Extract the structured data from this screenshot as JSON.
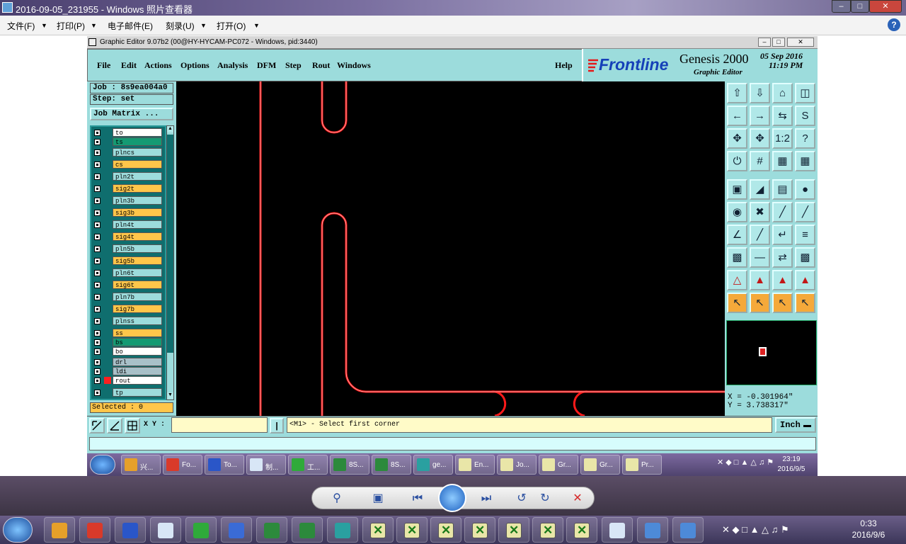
{
  "viewer": {
    "title": "2016-09-05_231955 - Windows 照片查看器",
    "menu": [
      "文件(F)",
      "打印(P)",
      "电子邮件(E)",
      "刻录(U)",
      "打开(O)"
    ],
    "help_icon": "?"
  },
  "genesis": {
    "window_title": "Graphic Editor 9.07b2 (00@HY-HYCAM-PC072 - Windows, pid:3440)",
    "menu": [
      "File",
      "Edit",
      "Actions",
      "Options",
      "Analysis",
      "DFM",
      "Step",
      "Rout",
      "Windows"
    ],
    "help": "Help",
    "brand": "Frontline",
    "product": "Genesis 2000",
    "subtitle": "Graphic Editor",
    "date": "05 Sep 2016",
    "time": "11:19 PM",
    "job": "Job : 8s9ea004a0",
    "step": "Step: set",
    "job_matrix": "Job Matrix ...",
    "layers": [
      {
        "name": "to",
        "color": "#ffffff"
      },
      {
        "name": "ts",
        "color": "#149a73"
      },
      {
        "name": "plncs",
        "color": "#9cdcdc"
      },
      {
        "name": "cs",
        "color": "#ffc64a"
      },
      {
        "name": "pln2t",
        "color": "#9cdcdc"
      },
      {
        "name": "sig2t",
        "color": "#ffc64a"
      },
      {
        "name": "pln3b",
        "color": "#9cdcdc"
      },
      {
        "name": "sig3b",
        "color": "#ffc64a"
      },
      {
        "name": "pln4t",
        "color": "#9cdcdc"
      },
      {
        "name": "sig4t",
        "color": "#ffc64a"
      },
      {
        "name": "pln5b",
        "color": "#9cdcdc"
      },
      {
        "name": "sig5b",
        "color": "#ffc64a"
      },
      {
        "name": "pln6t",
        "color": "#9cdcdc"
      },
      {
        "name": "sig6t",
        "color": "#ffc64a"
      },
      {
        "name": "pln7b",
        "color": "#9cdcdc"
      },
      {
        "name": "sig7b",
        "color": "#ffc64a"
      },
      {
        "name": "plnss",
        "color": "#9cdcdc"
      },
      {
        "name": "ss",
        "color": "#ffc64a"
      },
      {
        "name": "bs",
        "color": "#149a73"
      },
      {
        "name": "bo",
        "color": "#ffffff"
      },
      {
        "name": "drl",
        "color": "#a8c0c8"
      },
      {
        "name": "ldi",
        "color": "#a8c0c8"
      },
      {
        "name": "rout",
        "color": "#ffffff"
      },
      {
        "name": "tp",
        "color": "#9cdcdc"
      }
    ],
    "selected": "Selected : 0",
    "coord_x": "X = -0.301964\"",
    "coord_y": "Y = 3.738317\"",
    "xy_label": "X Y :",
    "xy_value": "",
    "prompt": "<M1> - Select first corner",
    "unit": "Inch"
  },
  "inner_taskbar": {
    "items": [
      "兴...",
      "Fo...",
      "To...",
      "制...",
      "工...",
      "8S...",
      "8S...",
      "ge...",
      "En...",
      "Jo...",
      "Gr...",
      "Gr...",
      "Pr..."
    ],
    "time": "23:19",
    "date": "2016/9/5"
  },
  "os_taskbar": {
    "time": "0:33",
    "date": "2016/9/6"
  },
  "colors": {
    "trace": "#ff0000",
    "panel": "#9cdcdc",
    "canvas": "#000000"
  }
}
